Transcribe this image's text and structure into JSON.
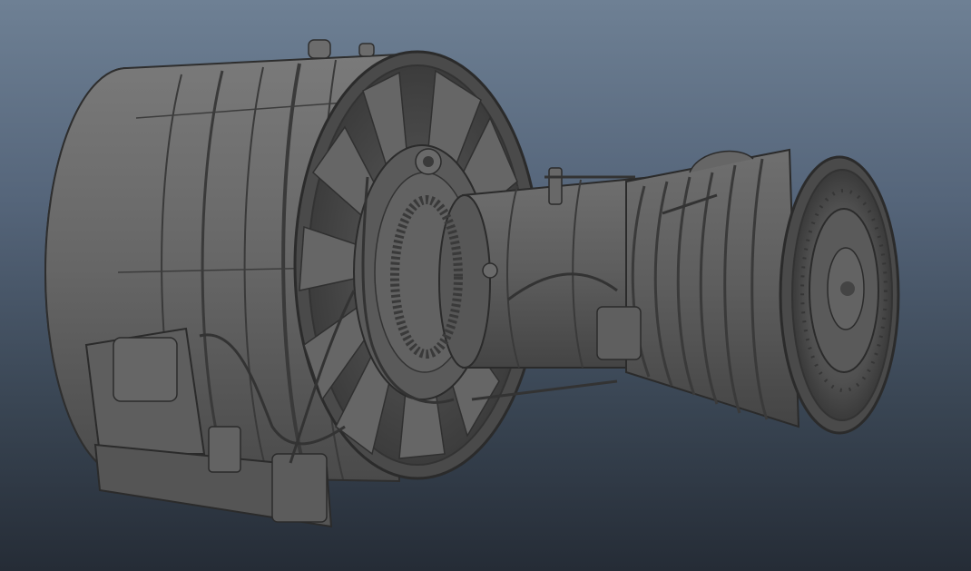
{
  "viewport": {
    "background_top": "#6e8094",
    "background_bottom": "#252c36"
  },
  "model": {
    "shade_light": "#777777",
    "shade_mid": "#5e5e5e",
    "shade_dark": "#3f3f3f",
    "line_color": "#2a2a2a"
  }
}
